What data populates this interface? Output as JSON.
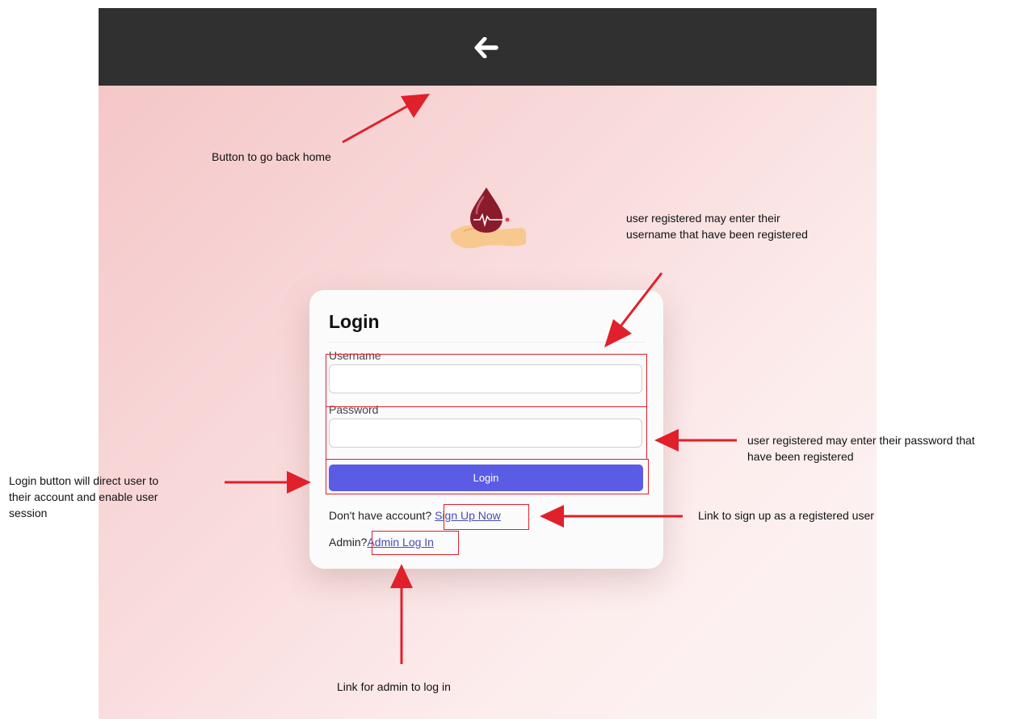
{
  "topbar": {
    "back_icon": "arrow-left-icon"
  },
  "logo": {
    "icon": "blood-drop-hand-icon"
  },
  "login_card": {
    "title": "Login",
    "username_label": "Username",
    "username_value": "",
    "password_label": "Password",
    "password_value": "",
    "login_button": "Login",
    "signup_prompt": "Don't have account?",
    "signup_link": "Sign Up Now",
    "admin_prompt": "Admin?",
    "admin_link": "Admin Log In"
  },
  "annotations": {
    "back_home": "Button to go back home",
    "username_line1": "user registered may enter their",
    "username_line2": "username that have been registered",
    "password_line1": "user registered may enter their password that",
    "password_line2": "have been registered",
    "login_line1": "Login button will direct user to",
    "login_line2": "their account and enable user",
    "login_line3": "session",
    "signup": "Link to sign up as a registered user",
    "admin": "Link for admin to log in"
  },
  "colors": {
    "topbar": "#303030",
    "accent_button": "#5b5ce6",
    "link": "#4b4bb3",
    "annotation_red": "#e0202a",
    "blood_red": "#8b1a2b"
  }
}
